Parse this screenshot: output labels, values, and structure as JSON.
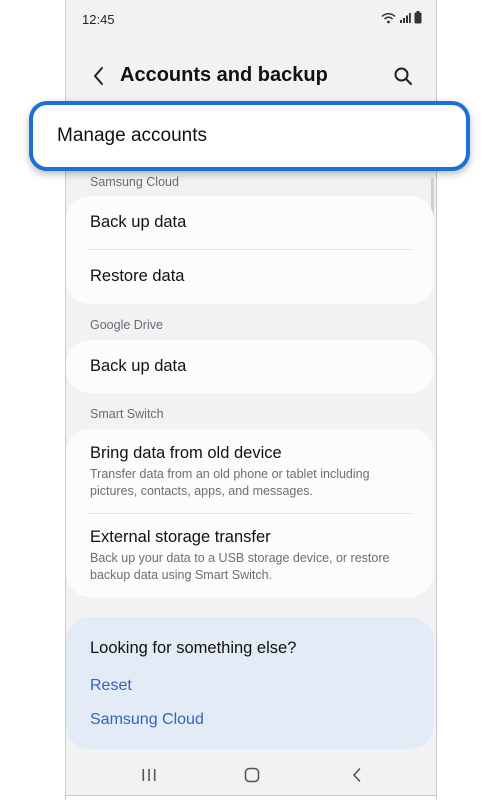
{
  "status_bar": {
    "time": "12:45"
  },
  "header": {
    "title": "Accounts and backup"
  },
  "manage_accounts": {
    "label": "Manage accounts"
  },
  "sections": {
    "samsung_cloud": {
      "label": "Samsung Cloud",
      "items": [
        {
          "title": "Back up data"
        },
        {
          "title": "Restore data"
        }
      ]
    },
    "google_drive": {
      "label": "Google Drive",
      "items": [
        {
          "title": "Back up data"
        }
      ]
    },
    "smart_switch": {
      "label": "Smart Switch",
      "items": [
        {
          "title": "Bring data from old device",
          "desc": [
            "Transfer data from an old phone or tablet including",
            "pictures, contacts, apps, and messages."
          ]
        },
        {
          "title": "External storage transfer",
          "desc": [
            "Back up your data to a USB storage device, or restore",
            "backup data using Smart Switch."
          ]
        }
      ]
    }
  },
  "suggestions": {
    "title": "Looking for something else?",
    "links": [
      "Reset",
      "Samsung Cloud"
    ]
  },
  "colors": {
    "accent_highlight": "#1b6fd6",
    "link": "#3565b8",
    "suggestion_bg": "#e3ebf6"
  }
}
